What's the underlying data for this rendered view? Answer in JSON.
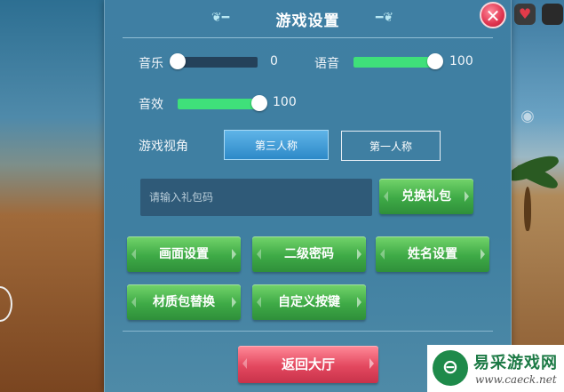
{
  "title": "游戏设置",
  "close_icon": "✕",
  "sliders": {
    "music": {
      "label": "音乐",
      "value": "0",
      "fraction": 0.0
    },
    "voice": {
      "label": "语音",
      "value": "100",
      "fraction": 1.0
    },
    "sfx": {
      "label": "音效",
      "value": "100",
      "fraction": 1.0
    }
  },
  "view": {
    "label": "游戏视角",
    "options": [
      "第三人称",
      "第一人称"
    ],
    "selected": "第三人称"
  },
  "gift": {
    "placeholder": "请输入礼包码",
    "button": "兑换礼包"
  },
  "buttons": {
    "graphics": "画面设置",
    "second_password": "二级密码",
    "name_settings": "姓名设置",
    "texture_pack": "材质包替换",
    "custom_keys": "自定义按键"
  },
  "return_button": "返回大厅",
  "watermark": {
    "logo_char": "⊖",
    "name": "易采游戏网",
    "url": "www.caeck.net"
  },
  "colors": {
    "panel": "#3f7fa3",
    "accent_green": "#3fe07a",
    "button_green": "#3eaa46",
    "button_red": "#e3485f"
  }
}
